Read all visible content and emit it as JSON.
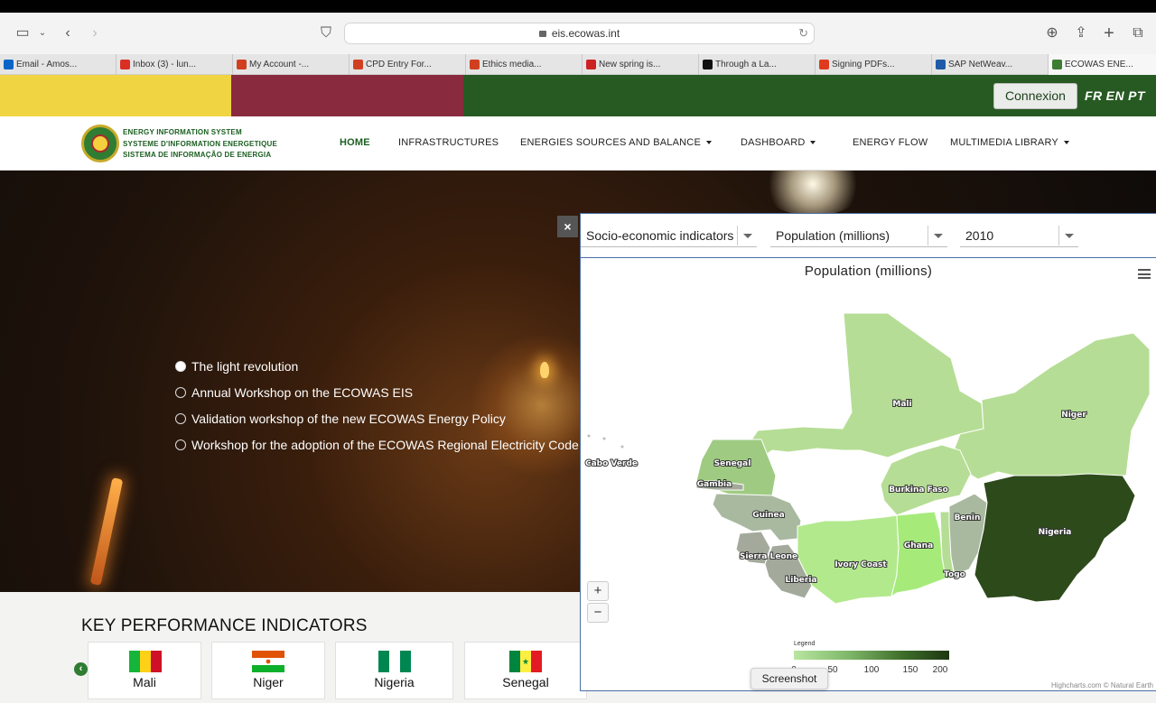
{
  "browser": {
    "url": "eis.ecowas.int",
    "tabs": [
      {
        "label": "Email - Amos...",
        "color": "#0a64c8"
      },
      {
        "label": "Inbox (3) - lun...",
        "color": "#d93025"
      },
      {
        "label": "My Account -...",
        "color": "#d04020"
      },
      {
        "label": "CPD Entry For...",
        "color": "#d04020"
      },
      {
        "label": "Ethics media...",
        "color": "#d04020"
      },
      {
        "label": "New spring is...",
        "color": "#cc2222"
      },
      {
        "label": "Through a La...",
        "color": "#111111"
      },
      {
        "label": "Signing PDFs...",
        "color": "#e03a1e"
      },
      {
        "label": "SAP NetWeav...",
        "color": "#1e5aa8"
      },
      {
        "label": "ECOWAS ENE...",
        "color": "#3c7d32"
      }
    ]
  },
  "site": {
    "band_colors": [
      "#f0d442",
      "#8a2a3e",
      "#275a22"
    ],
    "connexion": "Connexion",
    "languages": [
      "FR",
      "EN",
      "PT"
    ],
    "logo_lines": [
      "ENERGY INFORMATION SYSTEM",
      "SYSTEME D'INFORMATION ENERGETIQUE",
      "SISTEMA DE INFORMAÇÃO DE ENERGIA"
    ],
    "nav": {
      "home": "HOME",
      "infrastructures": "INFRASTRUCTURES",
      "energies": "ENERGIES SOURCES AND BALANCE",
      "dashboard": "DASHBOARD",
      "energy_flow": "ENERGY FLOW",
      "multimedia": "MULTIMEDIA LIBRARY"
    }
  },
  "hero": {
    "slides": [
      {
        "label": "The light revolution",
        "active": true
      },
      {
        "label": "Annual Workshop on the ECOWAS EIS",
        "active": false
      },
      {
        "label": "Validation workshop of the new ECOWAS Energy Policy",
        "active": false
      },
      {
        "label": "Workshop for the adoption of the ECOWAS Regional Electricity Code",
        "active": false
      }
    ]
  },
  "kpi": {
    "title": "KEY PERFORMANCE INDICATORS",
    "countries": [
      "Mali",
      "Niger",
      "Nigeria",
      "Senegal"
    ]
  },
  "map_panel": {
    "close": "×",
    "select_category": "Socio-economic indicators",
    "select_indicator": "Population (millions)",
    "select_year": "2010",
    "title": "Population (millions)",
    "zoom_in": "+",
    "zoom_out": "−",
    "legend_title": "Legend",
    "legend_ticks": [
      "0",
      "50",
      "100",
      "150",
      "200"
    ],
    "credits": "Highcharts.com © Natural Earth",
    "tooltip": "Screenshot",
    "country_labels": [
      "Mali",
      "Niger",
      "Cabo Verde",
      "Senegal",
      "Gambia",
      "Burkina Faso",
      "Guinea",
      "Benin",
      "Nigeria",
      "Ghana",
      "Sierra Leone",
      "Ivory Coast",
      "Togo",
      "Liberia"
    ],
    "colors": {
      "low": "#b6dd95",
      "mid_low": "#9ecb81",
      "mid": "#a9b9a0",
      "grey": "#a3aa9c",
      "ghana": "#a6eb7a",
      "ivory": "#b3e98d",
      "nigeria": "#2d4a1b"
    }
  }
}
